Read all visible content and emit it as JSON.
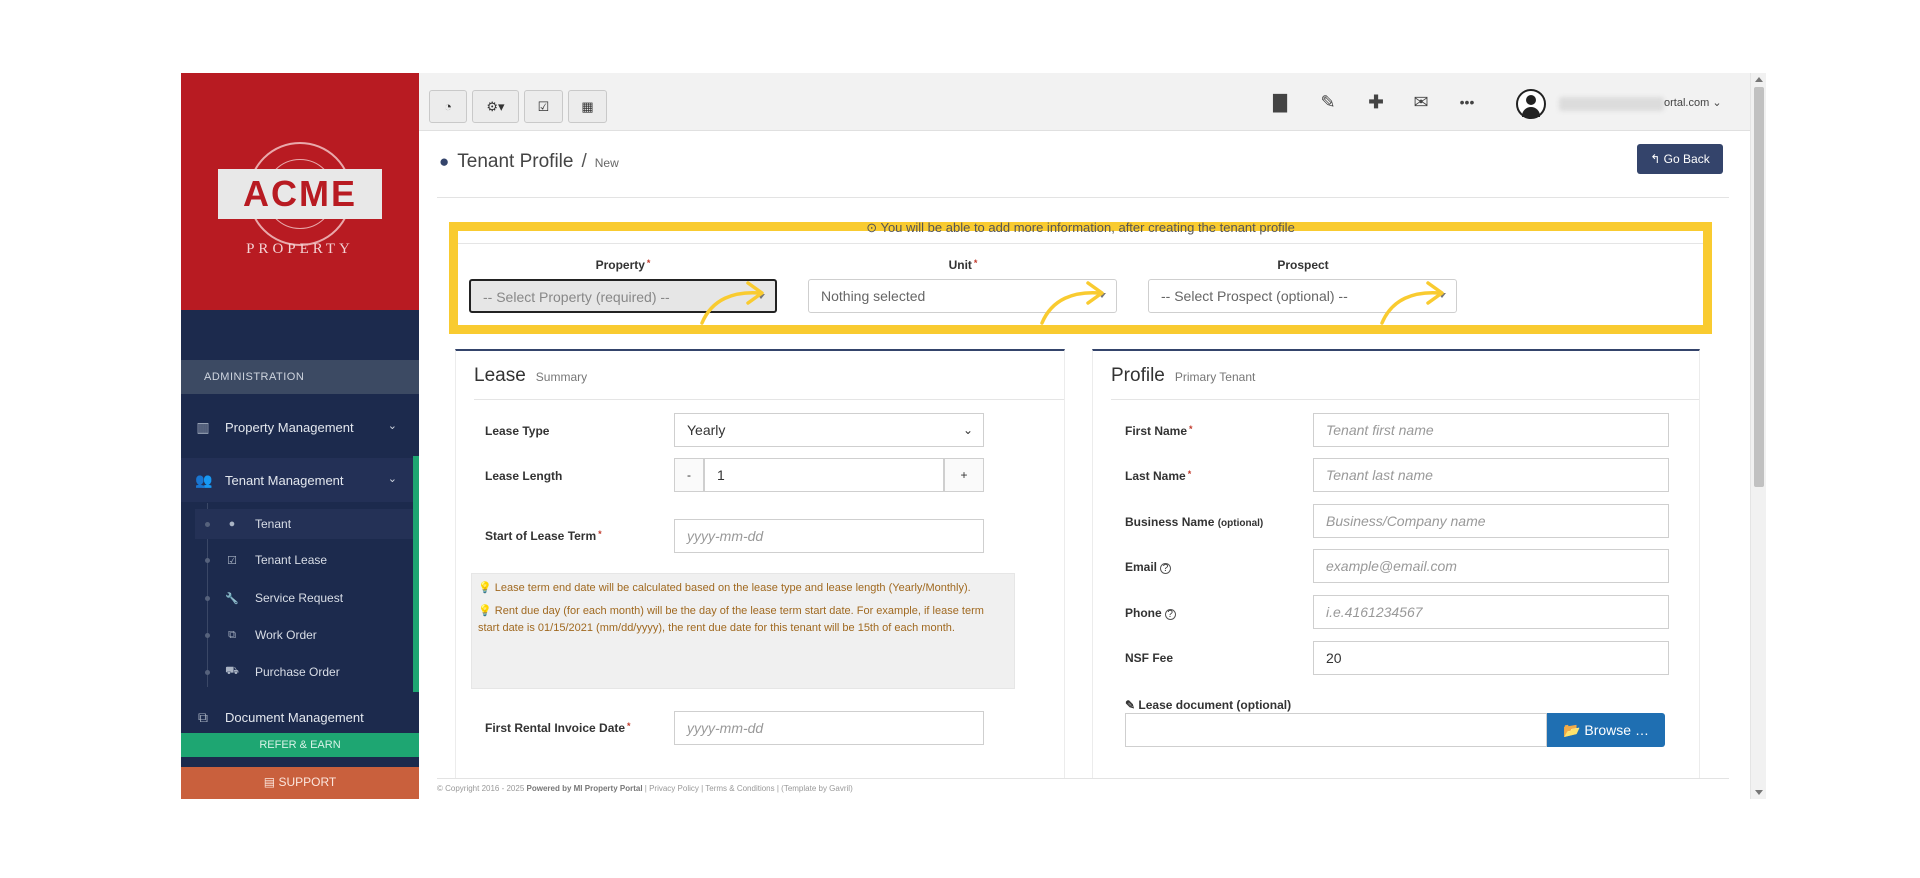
{
  "logo": {
    "brand": "ACME",
    "sub": "PROPERTY"
  },
  "sidebar": {
    "section_label": "ADMINISTRATION",
    "items": [
      {
        "label": "Property Management",
        "icon": "building-icon"
      },
      {
        "label": "Tenant Management",
        "icon": "users-icon"
      },
      {
        "label": "Document Management",
        "icon": "documents-icon"
      }
    ],
    "sub_items": [
      {
        "label": "Tenant",
        "icon": "user-icon"
      },
      {
        "label": "Tenant Lease",
        "icon": "calendar-check-icon"
      },
      {
        "label": "Service Request",
        "icon": "wrench-icon"
      },
      {
        "label": "Work Order",
        "icon": "copy-icon"
      },
      {
        "label": "Purchase Order",
        "icon": "truck-icon"
      }
    ],
    "refer_label": "REFER & EARN",
    "support_label": "SUPPORT"
  },
  "topbar": {
    "user_email_visible": "ortal.com",
    "icons": [
      "dashboard-icon",
      "gear-icon",
      "calendar-check-icon",
      "calculator-icon",
      "bar-chart-icon",
      "wrench-icon",
      "plus-icon",
      "envelope-icon",
      "ellipsis-icon",
      "avatar-icon"
    ]
  },
  "page": {
    "title": "Tenant Profile",
    "separator": "/",
    "crumb": "New",
    "go_back_label": "Go Back",
    "hint": "You will be able to add more information, after creating the tenant profile"
  },
  "selectors": {
    "property": {
      "label": "Property",
      "value": "-- Select Property (required) --"
    },
    "unit": {
      "label": "Unit",
      "value": "Nothing selected"
    },
    "prospect": {
      "label": "Prospect",
      "value": "-- Select Prospect (optional) --"
    }
  },
  "lease": {
    "title": "Lease",
    "subtitle": "Summary",
    "lease_type_label": "Lease Type",
    "lease_type_value": "Yearly",
    "lease_length_label": "Lease Length",
    "lease_length_value": "1",
    "minus": "-",
    "plus": "+",
    "start_label": "Start of Lease Term",
    "start_placeholder": "yyyy-mm-dd",
    "info_1": "Lease term end date will be calculated based on the lease type and lease length (Yearly/Monthly).",
    "info_2": "Rent due day (for each month) will be the day of the lease term start date. For example, if lease term start date is 01/15/2021 (mm/dd/yyyy), the rent due date for this tenant will be 15th of each month.",
    "first_invoice_label": "First Rental Invoice Date",
    "first_invoice_placeholder": "yyyy-mm-dd"
  },
  "profile": {
    "title": "Profile",
    "subtitle": "Primary Tenant",
    "first_name_label": "First Name",
    "first_name_placeholder": "Tenant first name",
    "last_name_label": "Last Name",
    "last_name_placeholder": "Tenant last name",
    "business_label": "Business Name",
    "business_opt": "(optional)",
    "business_placeholder": "Business/Company name",
    "email_label": "Email",
    "email_placeholder": "example@email.com",
    "phone_label": "Phone",
    "phone_placeholder": "i.e.4161234567",
    "nsf_label": "NSF Fee",
    "nsf_value": "20",
    "lease_doc_label": "Lease document (optional)",
    "browse_label": "Browse …"
  },
  "footer": {
    "copyright": "© Copyright 2016 - 2025",
    "powered": "Powered by MI Property Portal",
    "privacy": "Privacy Policy",
    "terms": "Terms & Conditions",
    "credit": "(Template by Gavril)"
  },
  "colors": {
    "sidebar": "#1c2a4d",
    "logo_bg": "#b81b22",
    "accent": "#34446b",
    "highlight": "#f9cb30",
    "green": "#1ea672",
    "support": "#c9603d",
    "browse": "#1f6fb2"
  }
}
